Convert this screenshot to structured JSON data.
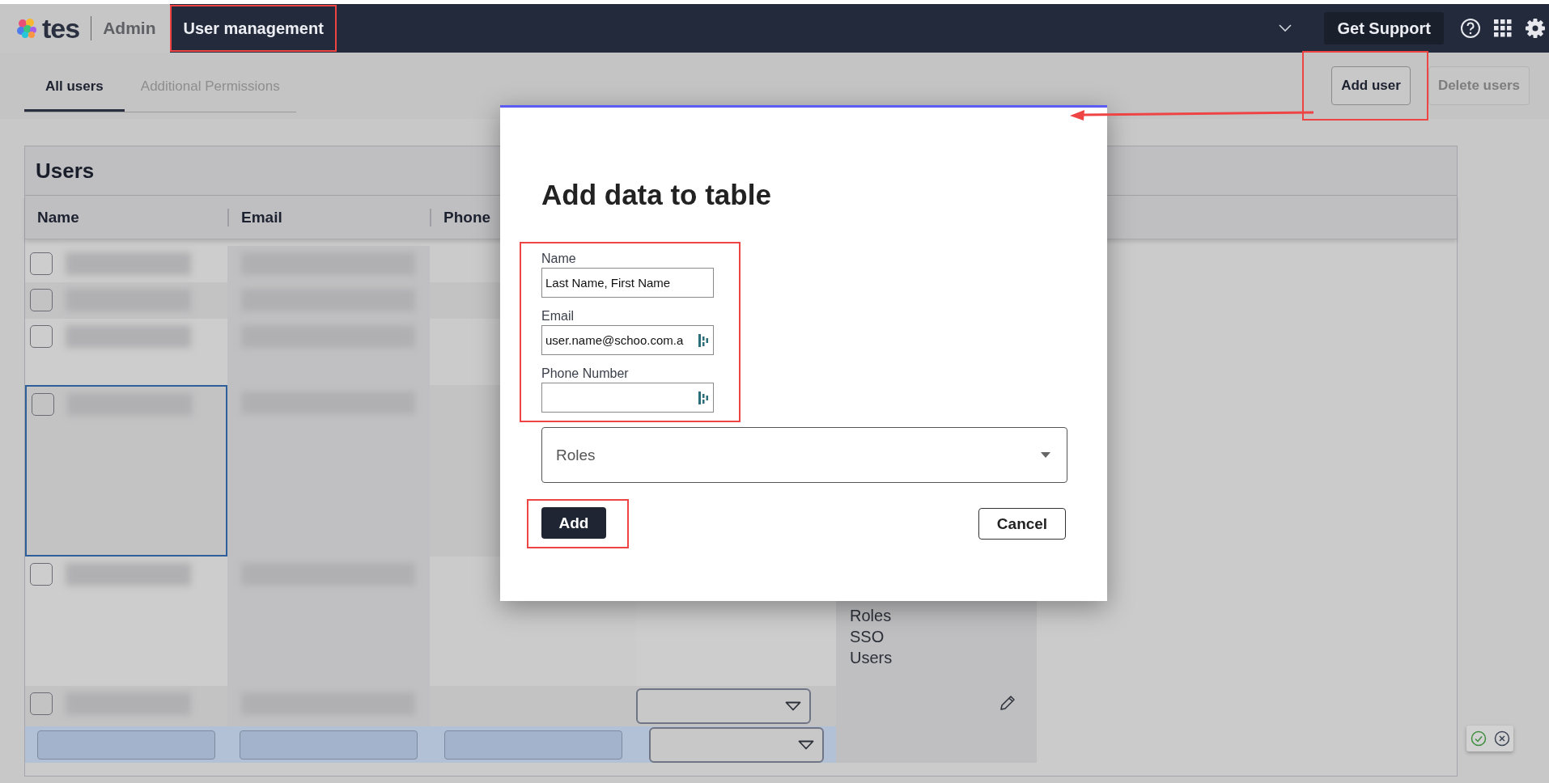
{
  "topbar": {
    "logo": "tes",
    "app": "Admin",
    "section": {
      "label": "User management",
      "highlighted": true
    },
    "support": "Get Support"
  },
  "tabs": [
    {
      "label": "All users",
      "selected": true
    },
    {
      "label": "Additional Permissions",
      "selected": false
    }
  ],
  "actions": [
    {
      "label": "Add user",
      "disabled": false,
      "highlighted": true
    },
    {
      "label": "Delete users",
      "disabled": true,
      "highlighted": false
    }
  ],
  "table": {
    "title": "Users",
    "columns": [
      "Name",
      "Email",
      "Phone"
    ],
    "rows": [
      {
        "kind": "user",
        "checked": false,
        "selected": false
      },
      {
        "kind": "user",
        "checked": false,
        "selected": false
      },
      {
        "kind": "user",
        "checked": false,
        "selected": false
      },
      {
        "kind": "user",
        "checked": false,
        "selected": true
      },
      {
        "kind": "user",
        "checked": false,
        "selected": false,
        "role_select": false,
        "permissions": [
          "Roles",
          "SSO",
          "Users"
        ]
      },
      {
        "kind": "user",
        "checked": false,
        "selected": false,
        "role_select": true
      },
      {
        "kind": "new",
        "role_select": true
      }
    ]
  },
  "dialog": {
    "title": "Add data to table",
    "fields_highlighted": true,
    "fields": [
      {
        "label": "Name",
        "value": "Last Name, First Name",
        "autofill": false
      },
      {
        "label": "Email",
        "value": "user.name@schoo.com.a",
        "autofill": true
      },
      {
        "label": "Phone Number",
        "autofill": true
      }
    ],
    "roles": {
      "placeholder": "Roles"
    },
    "buttons": [
      {
        "label": "Add",
        "kind": "primary",
        "highlighted": true
      },
      {
        "label": "Cancel",
        "kind": "secondary",
        "highlighted": false
      }
    ]
  }
}
